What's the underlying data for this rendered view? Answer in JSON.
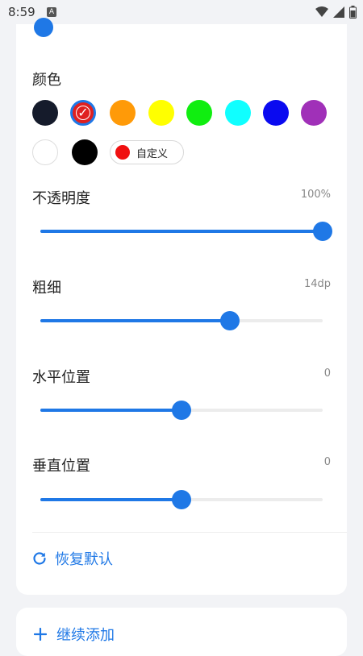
{
  "status_bar": {
    "time": "8:59",
    "app_icon_glyph": "A",
    "icons": [
      "wifi-icon",
      "signal-icon",
      "battery-icon"
    ]
  },
  "color_section": {
    "label": "颜色",
    "swatches": [
      {
        "name": "navy",
        "color": "#151b2b",
        "selected": false
      },
      {
        "name": "red",
        "color": "#e02020",
        "selected": true
      },
      {
        "name": "orange",
        "color": "#ff9a08",
        "selected": false
      },
      {
        "name": "yellow",
        "color": "#ffff00",
        "selected": false
      },
      {
        "name": "green",
        "color": "#10ee10",
        "selected": false
      },
      {
        "name": "cyan",
        "color": "#10ffff",
        "selected": false
      },
      {
        "name": "blue",
        "color": "#0a0af0",
        "selected": false
      },
      {
        "name": "purple",
        "color": "#a030b8",
        "selected": false
      },
      {
        "name": "white",
        "color": "#ffffff",
        "selected": false
      },
      {
        "name": "black",
        "color": "#000000",
        "selected": false
      }
    ],
    "selected_check": "✓",
    "custom": {
      "label": "自定义",
      "color": "#f01010"
    }
  },
  "sliders": {
    "opacity": {
      "label": "不透明度",
      "value_text": "100%",
      "fraction": 1.0
    },
    "thickness": {
      "label": "粗细",
      "value_text": "14dp",
      "fraction": 0.67
    },
    "horizontal": {
      "label": "水平位置",
      "value_text": "0",
      "fraction": 0.5
    },
    "vertical": {
      "label": "垂直位置",
      "value_text": "0",
      "fraction": 0.5
    }
  },
  "reset": {
    "label": "恢复默认"
  },
  "add_more": {
    "label": "继续添加"
  },
  "accent_color": "#1f78e6"
}
